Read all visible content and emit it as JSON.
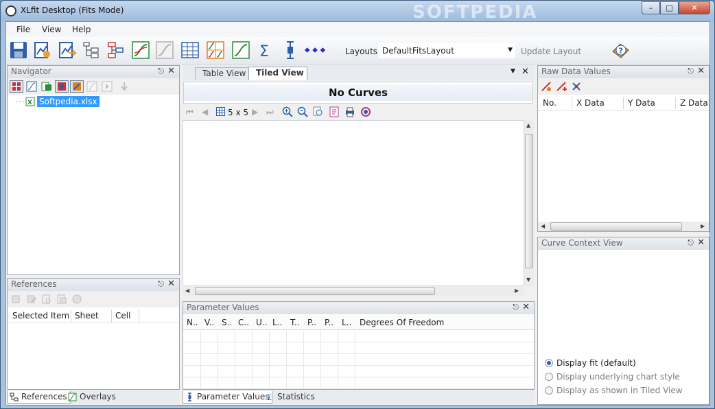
{
  "window": {
    "title": "XLfit Desktop (Fits Mode)",
    "watermark": "SOFTPEDIA"
  },
  "menu": {
    "file": "File",
    "view": "View",
    "help": "Help"
  },
  "toolbar": {
    "layouts_label": "Layouts:",
    "layouts_value": "DefaultFitsLayout",
    "update_layout": "Update Layout"
  },
  "navigator": {
    "title": "Navigator",
    "tree_item": "Softpedia.xlsx"
  },
  "references": {
    "title": "References",
    "columns": [
      "Selected Item",
      "Sheet",
      "Cell"
    ],
    "tabs": [
      "References",
      "Overlays"
    ]
  },
  "center": {
    "tabs": [
      "Table View",
      "Tiled View"
    ],
    "heading": "No Curves",
    "grid_size": "5 x 5"
  },
  "parameters": {
    "title": "Parameter Values",
    "columns": [
      "N..",
      "V..",
      "S..",
      "C..",
      "U..",
      "L..",
      "T..",
      "P..",
      "P..",
      "L..",
      "Degrees Of Freedom"
    ],
    "tabs": [
      "Parameter Values",
      "Statistics"
    ]
  },
  "raw_data": {
    "title": "Raw Data Values",
    "columns": [
      "No.",
      "X Data",
      "Y Data",
      "Z Data"
    ]
  },
  "curve_context": {
    "title": "Curve Context View",
    "options": [
      "Display fit (default)",
      "Display underlying chart style",
      "Display as shown in Tiled View"
    ],
    "selected_index": 0
  },
  "colors": {
    "accent": "#2b5fb5",
    "selection": "#3399ff",
    "chrome": "#a9c3de"
  }
}
